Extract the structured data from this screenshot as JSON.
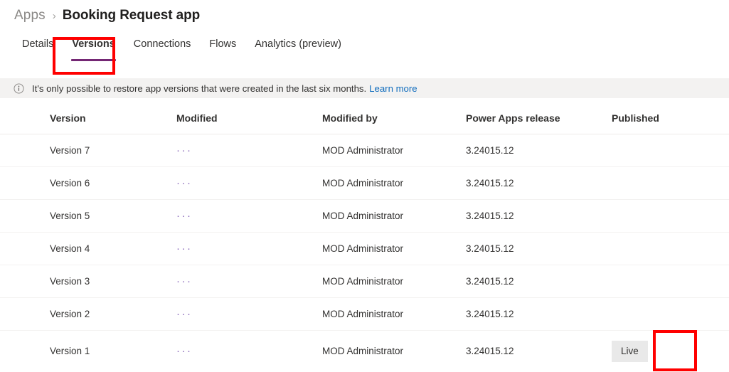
{
  "breadcrumb": {
    "parent": "Apps",
    "separator": "›",
    "current": "Booking Request app"
  },
  "tabs": [
    {
      "label": "Details",
      "selected": false
    },
    {
      "label": "Versions",
      "selected": true
    },
    {
      "label": "Connections",
      "selected": false
    },
    {
      "label": "Flows",
      "selected": false
    },
    {
      "label": "Analytics (preview)",
      "selected": false
    }
  ],
  "banner": {
    "icon": "info-circle-icon",
    "text": "It's only possible to restore app versions that were created in the last six months.",
    "link_text": "Learn more"
  },
  "table": {
    "columns": [
      "Version",
      "Modified",
      "Modified by",
      "Power Apps release",
      "Published"
    ],
    "rows": [
      {
        "version": "Version 7",
        "modified": "···",
        "modified_by": "MOD Administrator",
        "release": "3.24015.12",
        "published": ""
      },
      {
        "version": "Version 6",
        "modified": "···",
        "modified_by": "MOD Administrator",
        "release": "3.24015.12",
        "published": ""
      },
      {
        "version": "Version 5",
        "modified": "···",
        "modified_by": "MOD Administrator",
        "release": "3.24015.12",
        "published": ""
      },
      {
        "version": "Version 4",
        "modified": "···",
        "modified_by": "MOD Administrator",
        "release": "3.24015.12",
        "published": ""
      },
      {
        "version": "Version 3",
        "modified": "···",
        "modified_by": "MOD Administrator",
        "release": "3.24015.12",
        "published": ""
      },
      {
        "version": "Version 2",
        "modified": "···",
        "modified_by": "MOD Administrator",
        "release": "3.24015.12",
        "published": ""
      },
      {
        "version": "Version 1",
        "modified": "···",
        "modified_by": "MOD Administrator",
        "release": "3.24015.12",
        "published": "Live"
      }
    ]
  },
  "annotations": [
    {
      "name": "versions-tab-highlight",
      "color": "#ff0000"
    },
    {
      "name": "live-badge-highlight",
      "color": "#ff0000"
    }
  ],
  "colors": {
    "accent_underline": "#742774",
    "link": "#0f6cbd",
    "banner_bg": "#f3f2f1",
    "badge_bg": "#e9e9e9",
    "annotation": "#ff0000"
  }
}
